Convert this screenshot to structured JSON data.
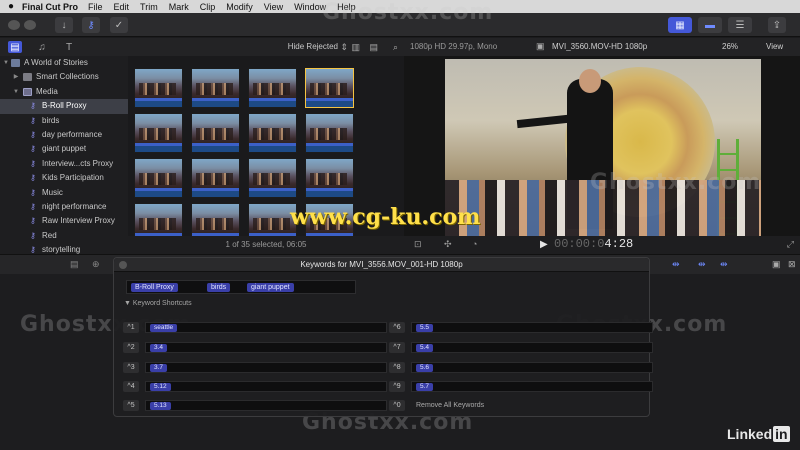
{
  "menubar": {
    "apple": "",
    "app_name": "Final Cut Pro",
    "items": [
      "File",
      "Edit",
      "Trim",
      "Mark",
      "Clip",
      "Modify",
      "View",
      "Window",
      "Help"
    ]
  },
  "sidebar": {
    "items": [
      {
        "label": "A World of Stories",
        "type": "library"
      },
      {
        "label": "Smart Collections",
        "type": "folder"
      },
      {
        "label": "Media",
        "type": "event"
      },
      {
        "label": "B-Roll Proxy",
        "type": "keyword",
        "selected": true
      },
      {
        "label": "birds",
        "type": "keyword"
      },
      {
        "label": "day performance",
        "type": "keyword"
      },
      {
        "label": "giant puppet",
        "type": "keyword"
      },
      {
        "label": "Interview...cts Proxy",
        "type": "keyword"
      },
      {
        "label": "Kids Participation",
        "type": "keyword"
      },
      {
        "label": "Music",
        "type": "keyword"
      },
      {
        "label": "night performance",
        "type": "keyword"
      },
      {
        "label": "Raw Interview Proxy",
        "type": "keyword"
      },
      {
        "label": "Red",
        "type": "keyword"
      },
      {
        "label": "storytelling",
        "type": "keyword"
      }
    ]
  },
  "browser": {
    "filter": "Hide Rejected",
    "status": "1 of 35 selected, 06:05"
  },
  "viewer": {
    "format": "1080p HD 29.97p, Mono",
    "clip_name": "MVI_3560.MOV-HD 1080p",
    "zoom": "26%",
    "view_menu": "View",
    "timecode_dim": "00:00:0",
    "timecode_bright": "4:28"
  },
  "keyword_editor": {
    "title": "Keywords for MVI_3556.MOV_001-HD 1080p",
    "keywords": [
      "B-Roll Proxy",
      "birds",
      "giant puppet"
    ],
    "shortcuts_label": "Keyword Shortcuts",
    "shortcuts": [
      {
        "key": "^1",
        "value": "seattle"
      },
      {
        "key": "^2",
        "value": "3.4"
      },
      {
        "key": "^3",
        "value": "3.7"
      },
      {
        "key": "^4",
        "value": "5.12"
      },
      {
        "key": "^5",
        "value": "5.13"
      },
      {
        "key": "^6",
        "value": "5.5"
      },
      {
        "key": "^7",
        "value": "5.4"
      },
      {
        "key": "^8",
        "value": "5.6"
      },
      {
        "key": "^9",
        "value": "5.7"
      },
      {
        "key": "^0",
        "value": "Remove All Keywords",
        "plain": true
      }
    ]
  },
  "watermarks": {
    "ghost": "Ghostxx.com",
    "cg": "www.cg-ku.com",
    "linkedin_a": "Linked",
    "linkedin_b": "in"
  }
}
